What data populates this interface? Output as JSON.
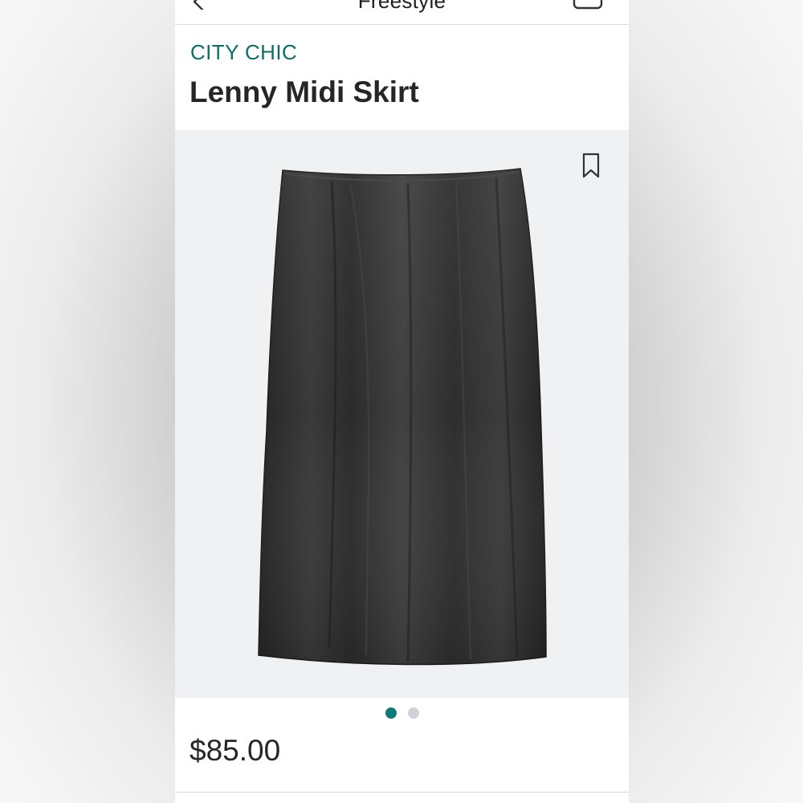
{
  "nav": {
    "title": "Freestyle",
    "back_icon": "chevron-left-icon",
    "bag_icon": "shopping-bag-icon"
  },
  "product": {
    "brand": "CITY CHIC",
    "name": "Lenny Midi Skirt",
    "price": "$85.00",
    "image": "black satin midi skirt",
    "bookmark_icon": "bookmark-icon"
  },
  "carousel": {
    "page_count": 2,
    "active_index": 0
  },
  "colors": {
    "brand": "#0c6e66",
    "active_dot": "#0f7b78",
    "inactive_dot": "#cfd2d6",
    "image_bg": "#f0f1f3"
  }
}
